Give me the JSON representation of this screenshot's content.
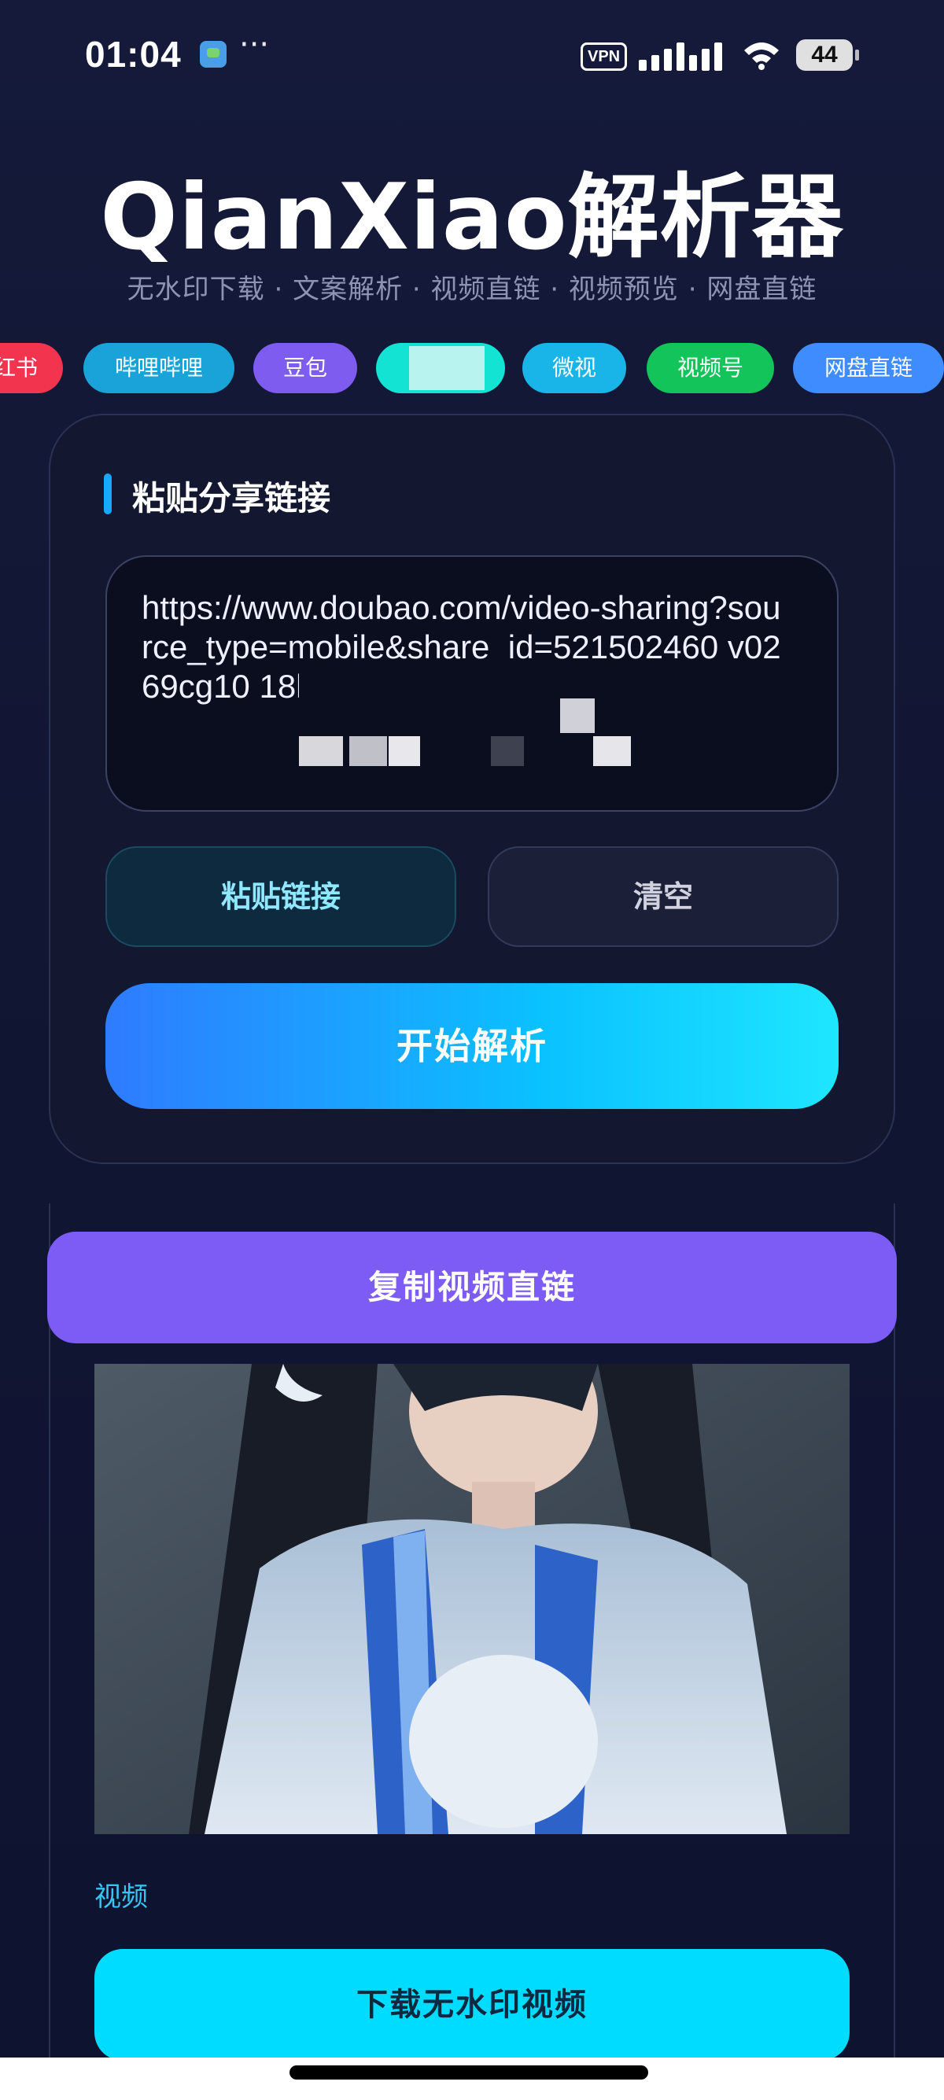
{
  "status_bar": {
    "time": "01:04",
    "more_label": "···",
    "vpn_label": "VPN",
    "battery_level": "44"
  },
  "header": {
    "title": "QianXiao解析器",
    "subtitle": "无水印下载 · 文案解析 · 视频直链 · 视频预览 · 网盘直链"
  },
  "platform_chips": [
    {
      "label": "红书",
      "color": "#f2344e"
    },
    {
      "label": "哔哩哔哩",
      "color": "#1aa3d8"
    },
    {
      "label": "豆包",
      "color": "#7f5cf0"
    },
    {
      "label": "",
      "color": "#12e3d3"
    },
    {
      "label": "微视",
      "color": "#1ab5e8"
    },
    {
      "label": "视频号",
      "color": "#12c45a"
    },
    {
      "label": "网盘直链",
      "color": "#3f8cff"
    }
  ],
  "card": {
    "title": "粘贴分享链接",
    "url_value": "https://www.doubao.com/video-sharing?source_type=mobile&share_id=521502460 v0269cg10 18bhg",
    "paste_button": "粘贴链接",
    "clear_button": "清空",
    "start_button": "开始解析"
  },
  "result": {
    "copy_button": "复制视频直链",
    "media_label": "视频",
    "download_button": "下载无水印视频"
  },
  "colors": {
    "background": "#121735",
    "accent_blue": "#1ac2ff",
    "copy_purple": "#7d5cf5",
    "download_cyan": "#00dcff"
  }
}
